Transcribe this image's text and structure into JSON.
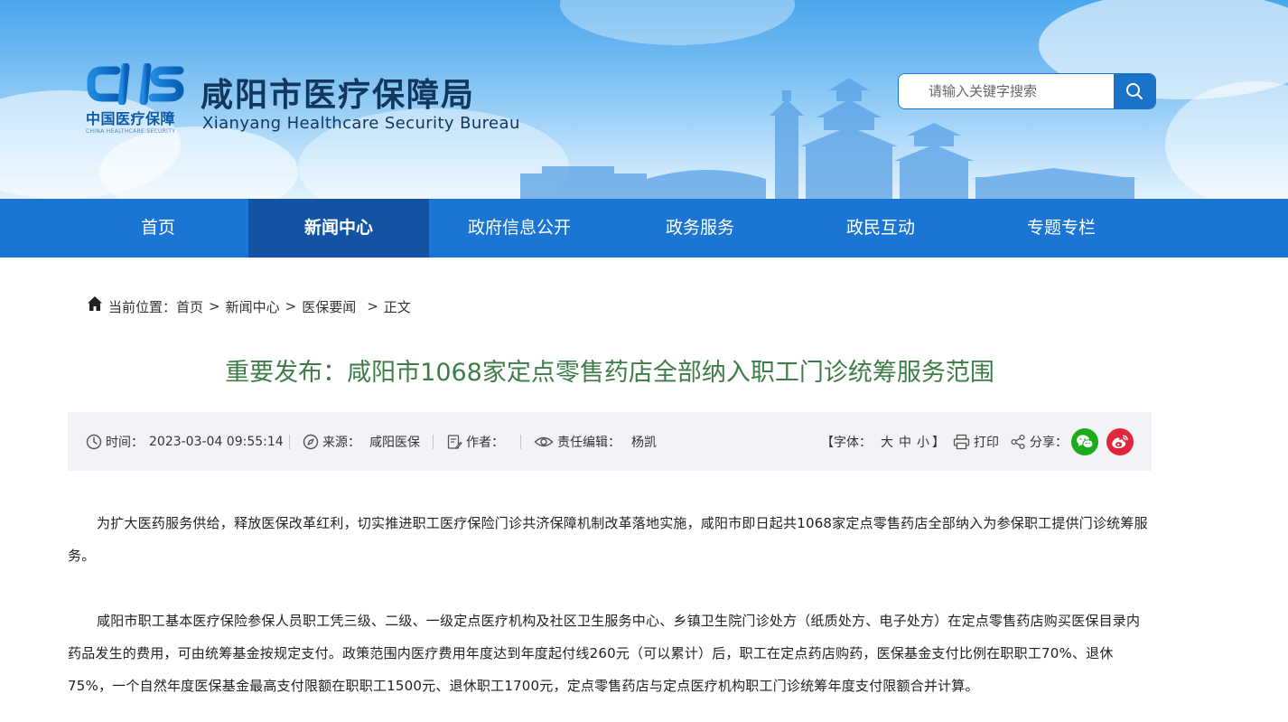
{
  "header": {
    "logo_cn": "中国医疗保障",
    "logo_en": "CHINA HEALTHCARE SECURITY",
    "site_title": "咸阳市医疗保障局",
    "site_subtitle": "Xianyang Healthcare Security Bureau"
  },
  "search": {
    "placeholder": "请输入关键字搜索"
  },
  "nav": {
    "items": [
      {
        "label": "首页"
      },
      {
        "label": "新闻中心"
      },
      {
        "label": "政府信息公开"
      },
      {
        "label": "政务服务"
      },
      {
        "label": "政民互动"
      },
      {
        "label": "专题专栏"
      }
    ],
    "active_index": 1
  },
  "breadcrumb": {
    "label": "当前位置：",
    "items": [
      "首页",
      "新闻中心",
      "医保要闻",
      "正文"
    ],
    "separator": ">"
  },
  "article": {
    "title": "重要发布：咸阳市1068家定点零售药店全部纳入职工门诊统筹服务范围",
    "meta": {
      "time_label": "时间：",
      "time_value": "2023-03-04 09:55:14",
      "source_label": "来源：",
      "source_value": "咸阳医保",
      "author_label": "作者：",
      "author_value": "",
      "editor_label": "责任编辑：",
      "editor_value": "杨凯",
      "font_label": "【字体：",
      "font_large": "大",
      "font_medium": "中",
      "font_small": "小",
      "font_close": "】",
      "print_label": "打印",
      "share_label": "分享："
    },
    "paragraphs": [
      "为扩大医药服务供给，释放医保改革红利，切实推进职工医疗保险门诊共济保障机制改革落地实施，咸阳市即日起共1068家定点零售药店全部纳入为参保职工提供门诊统筹服务。",
      "咸阳市职工基本医疗保险参保人员职工凭三级、二级、一级定点医疗机构及社区卫生服务中心、乡镇卫生院门诊处方（纸质处方、电子处方）在定点零售药店购买医保目录内药品发生的费用，可由统筹基金按规定支付。政策范围内医疗费用年度达到年度起付线260元（可以累计）后，职工在定点药店购药，医保基金支付比例在职职工70%、退休75%，一个自然年度医保基金最高支付限额在职职工1500元、退休职工1700元，定点零售药店与定点医疗机构职工门诊统筹年度支付限额合并计算。"
    ]
  },
  "colors": {
    "nav_bg": "#1a76d2",
    "nav_active_bg": "#1254a3",
    "title_green": "#3e7d47",
    "wechat_green": "#1aad19",
    "weibo_red": "#e0263e"
  },
  "icons": [
    "home-icon",
    "clock-icon",
    "compass-icon",
    "edit-icon",
    "eye-icon",
    "printer-icon",
    "share-icon",
    "search-icon",
    "wechat-icon",
    "weibo-icon"
  ]
}
